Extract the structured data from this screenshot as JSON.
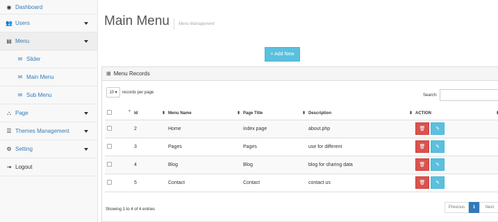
{
  "sidebar": {
    "items": [
      {
        "label": "Dashboard",
        "icon": "dashboard-icon"
      },
      {
        "label": "Users",
        "icon": "users-icon"
      },
      {
        "label": "Menu",
        "icon": "menu-icon"
      },
      {
        "label": "Slider",
        "icon": "envelope-icon"
      },
      {
        "label": "Main Menu",
        "icon": "envelope-icon"
      },
      {
        "label": "Sub Menu",
        "icon": "envelope-icon"
      },
      {
        "label": "Page",
        "icon": "sitemap-icon"
      },
      {
        "label": "Themes Management",
        "icon": "list-icon"
      },
      {
        "label": "Setting",
        "icon": "cogs-icon"
      },
      {
        "label": "Logout",
        "icon": "sign-out-icon"
      }
    ]
  },
  "header": {
    "title": "Main Menu",
    "subtitle": "Menu Management"
  },
  "toolbar": {
    "add_label": "+ Add New"
  },
  "panel": {
    "title": "Menu Records"
  },
  "table_controls": {
    "length_value": "10",
    "length_suffix": "records per page",
    "search_label": "Search:"
  },
  "table": {
    "columns": [
      "Id",
      "Menu Name",
      "Page Title",
      "Description",
      "ACTION"
    ],
    "rows": [
      {
        "id": "2",
        "name": "Home",
        "page": "index page",
        "desc": "about.php"
      },
      {
        "id": "3",
        "name": "Pages",
        "page": "Pages",
        "desc": "use for different"
      },
      {
        "id": "4",
        "name": "Blog",
        "page": "Blog",
        "desc": "blog for sharing data"
      },
      {
        "id": "5",
        "name": "Contact",
        "page": "Contact",
        "desc": "contact us"
      }
    ]
  },
  "footer": {
    "info": "Showing 1 to 4 of 4 entries"
  },
  "pagination": {
    "prev": "Previous",
    "current": "1",
    "next": "Next"
  },
  "colors": {
    "accent": "#337ab7",
    "info": "#5bc0de",
    "danger": "#d9534f"
  }
}
